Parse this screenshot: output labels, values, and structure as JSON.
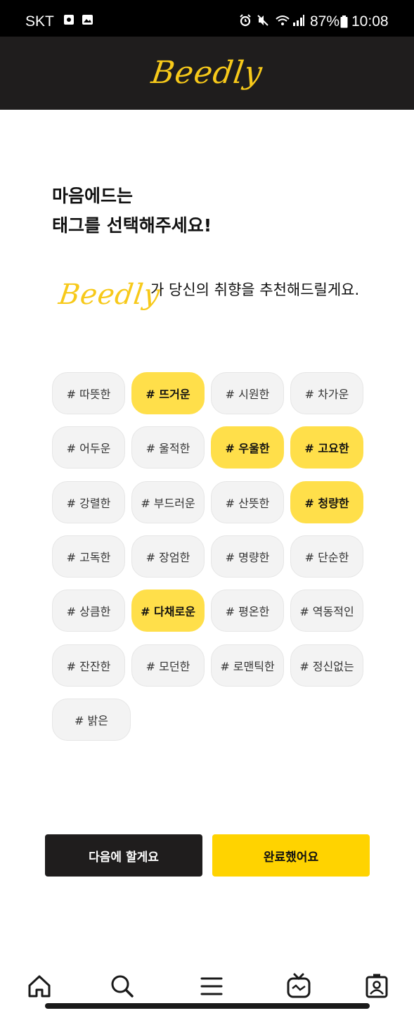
{
  "status_bar": {
    "carrier": "SKT",
    "battery": "87%",
    "time": "10:08"
  },
  "header": {
    "logo": "Beedly"
  },
  "headline": {
    "line1": "마음에드는",
    "line2": "태그를 선택해주세요!"
  },
  "recommendation": {
    "logo": "Beedly",
    "text": "가 당신의 취향을 추천해드릴게요."
  },
  "tags": [
    {
      "label": "# 따뜻한",
      "selected": false
    },
    {
      "label": "# 뜨거운",
      "selected": true
    },
    {
      "label": "# 시원한",
      "selected": false
    },
    {
      "label": "# 차가운",
      "selected": false
    },
    {
      "label": "# 어두운",
      "selected": false
    },
    {
      "label": "# 울적한",
      "selected": false
    },
    {
      "label": "# 우울한",
      "selected": true
    },
    {
      "label": "# 고요한",
      "selected": true
    },
    {
      "label": "# 강렬한",
      "selected": false
    },
    {
      "label": "# 부드러운",
      "selected": false
    },
    {
      "label": "# 산뜻한",
      "selected": false
    },
    {
      "label": "# 청량한",
      "selected": true
    },
    {
      "label": "# 고독한",
      "selected": false
    },
    {
      "label": "# 장엄한",
      "selected": false
    },
    {
      "label": "# 명량한",
      "selected": false
    },
    {
      "label": "# 단순한",
      "selected": false
    },
    {
      "label": "# 상큼한",
      "selected": false
    },
    {
      "label": "# 다채로운",
      "selected": true
    },
    {
      "label": "# 평온한",
      "selected": false
    },
    {
      "label": "# 역동적인",
      "selected": false
    },
    {
      "label": "# 잔잔한",
      "selected": false
    },
    {
      "label": "# 모던한",
      "selected": false
    },
    {
      "label": "# 로맨틱한",
      "selected": false
    },
    {
      "label": "# 정신없는",
      "selected": false
    },
    {
      "label": "# 밝은",
      "selected": false
    }
  ],
  "buttons": {
    "skip": "다음에 할게요",
    "done": "완료했어요"
  },
  "nav": [
    {
      "icon": "home-icon"
    },
    {
      "icon": "search-icon"
    },
    {
      "icon": "menu-icon"
    },
    {
      "icon": "tv-icon"
    },
    {
      "icon": "profile-icon"
    }
  ],
  "colors": {
    "accent": "#ffd300",
    "selected_tag": "#ffdf4a",
    "header_bg": "#1f1d1d",
    "logo": "#f7c91a"
  }
}
